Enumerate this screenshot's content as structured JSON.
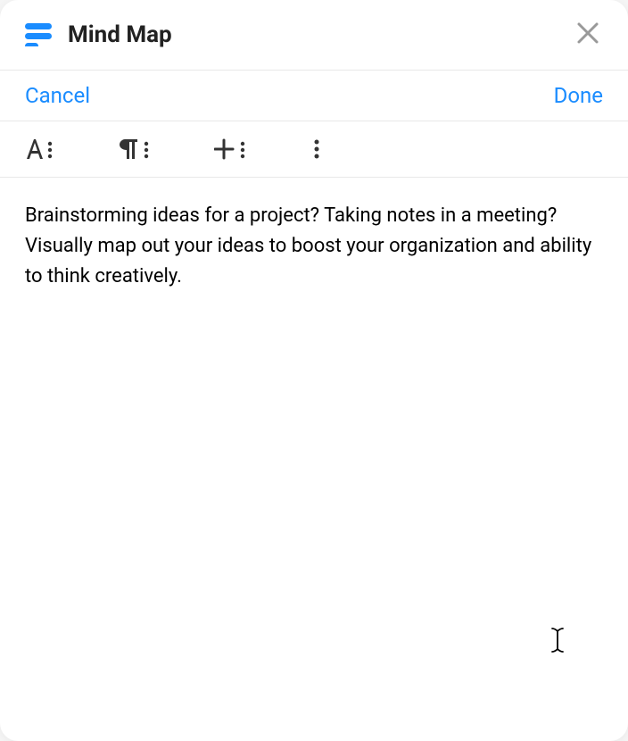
{
  "header": {
    "title": "Mind Map"
  },
  "actions": {
    "cancel_label": "Cancel",
    "done_label": "Done"
  },
  "content": {
    "text": "Brainstorming ideas for a project? Taking notes in a meeting? Visually map out your ideas to boost your organization and ability to think creatively."
  }
}
